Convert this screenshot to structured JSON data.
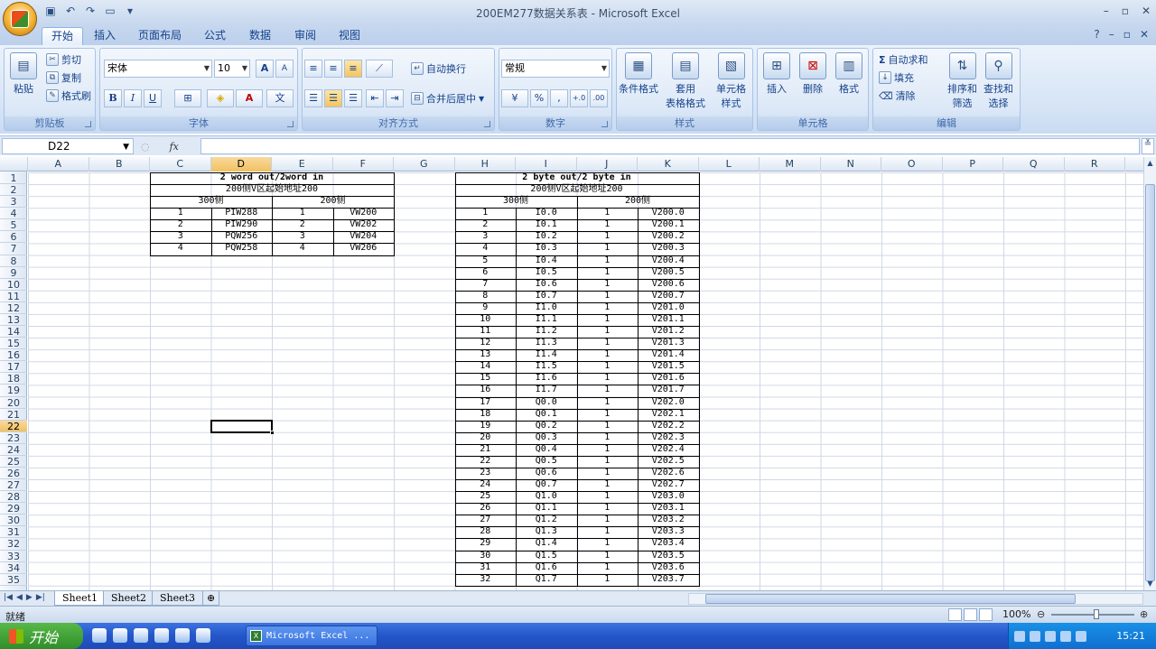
{
  "window": {
    "title": "200EM277数据关系表 - Microsoft Excel",
    "controls": [
      "–",
      "▫",
      "✕"
    ],
    "ribbon_controls": [
      "?",
      "–",
      "▫",
      "✕"
    ]
  },
  "quick_access": [
    "save-icon",
    "undo-icon",
    "redo-icon",
    "open-icon",
    "customize-icon"
  ],
  "tabs": [
    {
      "label": "开始",
      "active": true
    },
    {
      "label": "插入"
    },
    {
      "label": "页面布局"
    },
    {
      "label": "公式"
    },
    {
      "label": "数据"
    },
    {
      "label": "审阅"
    },
    {
      "label": "视图"
    }
  ],
  "ribbon": {
    "clipboard": {
      "label": "剪贴板",
      "paste": "粘贴",
      "cut": "剪切",
      "copy": "复制",
      "format_painter": "格式刷"
    },
    "font": {
      "label": "字体",
      "name": "宋体",
      "size": "10",
      "bold": "B",
      "italic": "I",
      "underline": "U",
      "grow": "A",
      "shrink": "A",
      "font_color": "A",
      "phonetic": "文"
    },
    "alignment": {
      "label": "对齐方式",
      "wrap": "自动换行",
      "merge": "合并后居中"
    },
    "number": {
      "label": "数字",
      "format": "常规",
      "percent": "%",
      "comma": ",",
      "inc_decimal": "+.0",
      "dec_decimal": ".00"
    },
    "styles": {
      "label": "样式",
      "conditional": "条件格式",
      "table_format_1": "套用",
      "table_format_2": "表格格式",
      "cell_styles_1": "单元格",
      "cell_styles_2": "样式"
    },
    "cells": {
      "label": "单元格",
      "insert": "插入",
      "delete": "删除",
      "format": "格式"
    },
    "editing": {
      "label": "编辑",
      "autosum": "自动求和",
      "fill": "填充",
      "clear": "清除",
      "sort_1": "排序和",
      "sort_2": "筛选",
      "find_1": "查找和",
      "find_2": "选择"
    }
  },
  "formula_bar": {
    "name_box": "D22",
    "fx": "fx",
    "content": ""
  },
  "columns": [
    "A",
    "B",
    "C",
    "D",
    "E",
    "F",
    "G",
    "H",
    "I",
    "J",
    "K",
    "L",
    "M",
    "N",
    "O",
    "P",
    "Q",
    "R"
  ],
  "rows": [
    "1",
    "2",
    "3",
    "4",
    "5",
    "6",
    "7",
    "8",
    "9",
    "10",
    "11",
    "12",
    "13",
    "14",
    "15",
    "16",
    "17",
    "18",
    "19",
    "20",
    "21",
    "22",
    "23",
    "24",
    "25",
    "26",
    "27",
    "28",
    "29",
    "30",
    "31",
    "32",
    "33",
    "34",
    "35"
  ],
  "selected_cell": {
    "col": "D",
    "row": "22"
  },
  "table1": {
    "title": "2 word out/2word in",
    "subtitle": "200侧V区起始地址200",
    "side_300": "300侧",
    "side_200": "200侧",
    "rows": [
      [
        "1",
        "PIW288",
        "1",
        "VW200"
      ],
      [
        "2",
        "PIW290",
        "2",
        "VW202"
      ],
      [
        "3",
        "PQW256",
        "3",
        "VW204"
      ],
      [
        "4",
        "PQW258",
        "4",
        "VW206"
      ]
    ]
  },
  "table2": {
    "title": "2 byte out/2 byte in",
    "subtitle": "200侧V区起始地址200",
    "side_300": "300侧",
    "side_200": "200侧",
    "rows": [
      [
        "1",
        "I0.0",
        "1",
        "V200.0"
      ],
      [
        "2",
        "I0.1",
        "1",
        "V200.1"
      ],
      [
        "3",
        "I0.2",
        "1",
        "V200.2"
      ],
      [
        "4",
        "I0.3",
        "1",
        "V200.3"
      ],
      [
        "5",
        "I0.4",
        "1",
        "V200.4"
      ],
      [
        "6",
        "I0.5",
        "1",
        "V200.5"
      ],
      [
        "7",
        "I0.6",
        "1",
        "V200.6"
      ],
      [
        "8",
        "I0.7",
        "1",
        "V200.7"
      ],
      [
        "9",
        "I1.0",
        "1",
        "V201.0"
      ],
      [
        "10",
        "I1.1",
        "1",
        "V201.1"
      ],
      [
        "11",
        "I1.2",
        "1",
        "V201.2"
      ],
      [
        "12",
        "I1.3",
        "1",
        "V201.3"
      ],
      [
        "13",
        "I1.4",
        "1",
        "V201.4"
      ],
      [
        "14",
        "I1.5",
        "1",
        "V201.5"
      ],
      [
        "15",
        "I1.6",
        "1",
        "V201.6"
      ],
      [
        "16",
        "I1.7",
        "1",
        "V201.7"
      ],
      [
        "17",
        "Q0.0",
        "1",
        "V202.0"
      ],
      [
        "18",
        "Q0.1",
        "1",
        "V202.1"
      ],
      [
        "19",
        "Q0.2",
        "1",
        "V202.2"
      ],
      [
        "20",
        "Q0.3",
        "1",
        "V202.3"
      ],
      [
        "21",
        "Q0.4",
        "1",
        "V202.4"
      ],
      [
        "22",
        "Q0.5",
        "1",
        "V202.5"
      ],
      [
        "23",
        "Q0.6",
        "1",
        "V202.6"
      ],
      [
        "24",
        "Q0.7",
        "1",
        "V202.7"
      ],
      [
        "25",
        "Q1.0",
        "1",
        "V203.0"
      ],
      [
        "26",
        "Q1.1",
        "1",
        "V203.1"
      ],
      [
        "27",
        "Q1.2",
        "1",
        "V203.2"
      ],
      [
        "28",
        "Q1.3",
        "1",
        "V203.3"
      ],
      [
        "29",
        "Q1.4",
        "1",
        "V203.4"
      ],
      [
        "30",
        "Q1.5",
        "1",
        "V203.5"
      ],
      [
        "31",
        "Q1.6",
        "1",
        "V203.6"
      ],
      [
        "32",
        "Q1.7",
        "1",
        "V203.7"
      ]
    ]
  },
  "sheet_tabs": [
    {
      "label": "Sheet1",
      "active": true
    },
    {
      "label": "Sheet2"
    },
    {
      "label": "Sheet3"
    }
  ],
  "status": {
    "text": "就绪",
    "zoom": "100%",
    "zoom_minus": "⊖",
    "zoom_plus": "⊕"
  },
  "taskbar": {
    "start": "开始",
    "item": "Microsoft Excel ...",
    "clock": "15:21"
  }
}
